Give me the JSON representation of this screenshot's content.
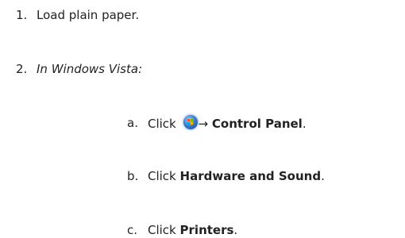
{
  "steps": [
    {
      "number": "1.",
      "text": "Load plain paper."
    },
    {
      "number": "2.",
      "text": "In Windows Vista:"
    }
  ],
  "substeps": [
    {
      "letter": "a.",
      "prefix": "Click",
      "icon": "windows-start-orb-icon",
      "arrow": "→",
      "bold": "Control Panel",
      "suffix": "."
    },
    {
      "letter": "b.",
      "prefix": "Click",
      "bold": "Hardware and Sound",
      "suffix": "."
    },
    {
      "letter": "c.",
      "prefix": "Click",
      "bold": "Printers",
      "suffix": "."
    }
  ]
}
